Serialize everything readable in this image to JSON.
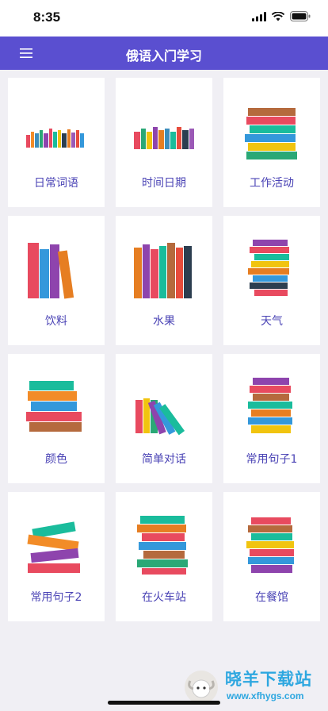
{
  "status_bar": {
    "time": "8:35"
  },
  "header": {
    "title": "俄语入门学习",
    "menu_icon": "hamburger-menu-icon"
  },
  "categories": [
    {
      "label": "日常词语",
      "icon": "books-row-icon"
    },
    {
      "label": "时间日期",
      "icon": "books-row-icon"
    },
    {
      "label": "工作活动",
      "icon": "book-stack-icon"
    },
    {
      "label": "饮料",
      "icon": "tall-books-icon"
    },
    {
      "label": "水果",
      "icon": "books-row-icon"
    },
    {
      "label": "天气",
      "icon": "book-stack-icon"
    },
    {
      "label": "颜色",
      "icon": "book-stack-icon"
    },
    {
      "label": "简单对话",
      "icon": "leaning-books-icon"
    },
    {
      "label": "常用句子1",
      "icon": "book-stack-icon"
    },
    {
      "label": "常用句子2",
      "icon": "book-stack-icon"
    },
    {
      "label": "在火车站",
      "icon": "book-stack-icon"
    },
    {
      "label": "在餐馆",
      "icon": "book-stack-icon"
    }
  ],
  "watermark": {
    "name": "晓羊下载站",
    "url": "www.xfhygs.com"
  }
}
